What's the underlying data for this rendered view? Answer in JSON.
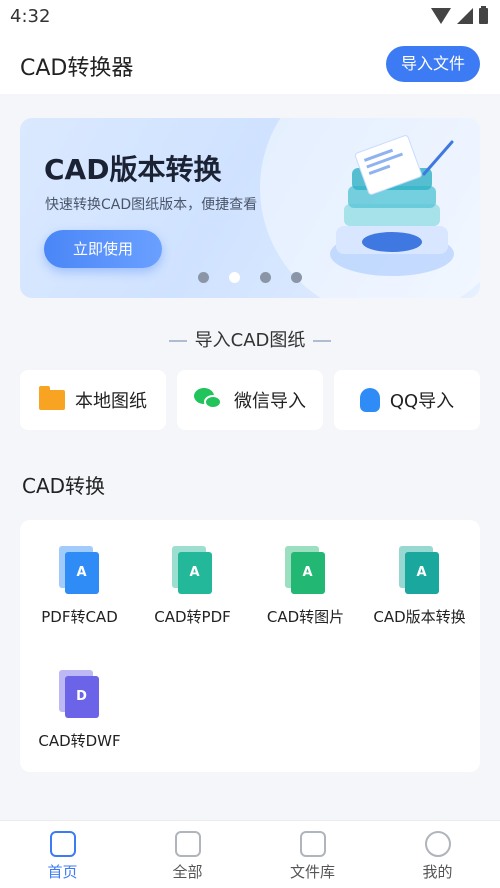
{
  "status_bar": {
    "time": "4:32"
  },
  "app_bar": {
    "title": "CAD转换器",
    "import_button": "导入文件"
  },
  "banner": {
    "title": "CAD版本转换",
    "subtitle": "快速转换CAD图纸版本，便捷查看",
    "button": "立即使用",
    "dots": 4,
    "active_dot": 2
  },
  "import_section": {
    "title": "导入CAD图纸",
    "sources": [
      {
        "label": "本地图纸",
        "icon": "folder-icon"
      },
      {
        "label": "微信导入",
        "icon": "wechat-icon"
      },
      {
        "label": "QQ导入",
        "icon": "qq-icon"
      }
    ]
  },
  "convert_section": {
    "title": "CAD转换",
    "tools": [
      {
        "label": "PDF转CAD",
        "icon": "pdf-to-cad-icon",
        "glyph": "A",
        "color": "#2f8cf7"
      },
      {
        "label": "CAD转PDF",
        "icon": "cad-to-pdf-icon",
        "glyph": "A",
        "color": "#23b89a"
      },
      {
        "label": "CAD转图片",
        "icon": "cad-to-image-icon",
        "glyph": "A",
        "color": "#22b873"
      },
      {
        "label": "CAD版本转换",
        "icon": "cad-version-icon",
        "glyph": "A",
        "color": "#1aa89e"
      },
      {
        "label": "CAD转DWF",
        "icon": "cad-to-dwf-icon",
        "glyph": "D",
        "color": "#6b63e8"
      }
    ]
  },
  "tab_bar": {
    "tabs": [
      {
        "label": "首页",
        "icon": "home-icon",
        "active": true
      },
      {
        "label": "全部",
        "icon": "grid-icon",
        "active": false
      },
      {
        "label": "文件库",
        "icon": "file-library-icon",
        "active": false
      },
      {
        "label": "我的",
        "icon": "profile-icon",
        "active": false
      }
    ]
  },
  "colors": {
    "accent": "#3d7bf5",
    "background": "#f4f6f9"
  }
}
